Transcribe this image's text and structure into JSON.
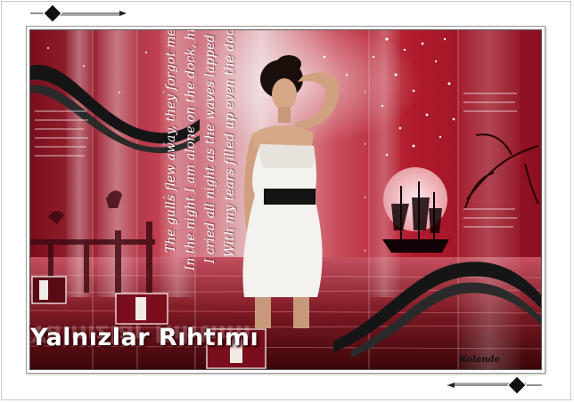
{
  "artwork": {
    "title": "Yalnızlar Rıhtımı",
    "signature": "Rolande",
    "poem_lines": [
      "The gulls flew away, they forgot me",
      "In the night I am alone on the dock, hit the sea",
      "I cried all night as the waves lapped at",
      "With my tears filled up even the dock"
    ],
    "colors": {
      "accent_red": "#b01a2c",
      "dark_red": "#5a0a12",
      "pink": "#e8a0a8",
      "ribbon": "#151515",
      "frame_border": "#9a9a9a"
    },
    "icons": [
      "diamond-ornament-icon",
      "arrow-line-icon"
    ]
  }
}
